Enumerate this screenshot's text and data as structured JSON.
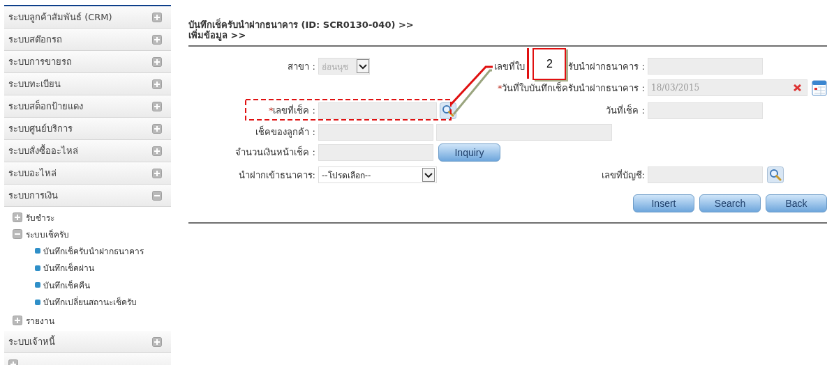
{
  "sidebar": {
    "items": [
      {
        "label": "ระบบลูกค้าสัมพันธ์ (CRM)",
        "expanded": false
      },
      {
        "label": "ระบบสต๊อกรถ",
        "expanded": false
      },
      {
        "label": "ระบบการขายรถ",
        "expanded": false
      },
      {
        "label": "ระบบทะเบียน",
        "expanded": false
      },
      {
        "label": "ระบบสต็อกป้ายแดง",
        "expanded": false
      },
      {
        "label": "ระบบศูนย์บริการ",
        "expanded": false
      },
      {
        "label": "ระบบสั่งซื้ออะไหล่",
        "expanded": false
      },
      {
        "label": "ระบบอะไหล่",
        "expanded": false
      },
      {
        "label": "ระบบการเงิน",
        "expanded": true,
        "children": [
          {
            "label": "รับชำระ",
            "expanded": false
          },
          {
            "label": "ระบบเช็ครับ",
            "expanded": true,
            "children": [
              {
                "label": "บันทึกเช็ครับนำฝากธนาคาร"
              },
              {
                "label": "บันทึกเช็คผ่าน"
              },
              {
                "label": "บันทึกเช็คคืน"
              },
              {
                "label": "บันทึกเปลี่ยนสถานะเช็ครับ"
              }
            ]
          },
          {
            "label": "รายงาน",
            "expanded": false
          }
        ]
      },
      {
        "label": "ระบบเจ้าหนี้",
        "expanded": false
      },
      {
        "expanded": false
      }
    ]
  },
  "page": {
    "title": "บันทึกเช็ครับนำฝากธนาคาร (ID: SCR0130-040) >>",
    "subtitle": "เพิ่มข้อมูล >>"
  },
  "form": {
    "branch": {
      "label": "สาขา :",
      "value": "อ่อนนุช",
      "disabled": true
    },
    "receipt_no": {
      "label_start": "เลขที่ใบ",
      "label_end": "รับนำฝากธนาคาร :"
    },
    "receipt_date": {
      "required_mark": "*",
      "label": "วันที่ใบบันทึกเช็ครับนำฝากธนาคาร :",
      "value": "18/03/2015",
      "disabled": true
    },
    "cheque_no": {
      "required_mark": "*",
      "label": "เลขที่เช็ค :"
    },
    "cheque_date": {
      "label": "วันที่เช็ค :"
    },
    "customer_cheque": {
      "label": "เช็คของลูกค้า :"
    },
    "amount": {
      "label": "จำนวนเงินหน้าเช็ค :"
    },
    "inquiry_button": "Inquiry",
    "deposit_bank": {
      "label": "นำฝากเข้าธนาคาร:",
      "value": "--โปรดเลือก--"
    },
    "account_no": {
      "label": "เลขที่บัญชี:"
    }
  },
  "buttons": [
    "Insert",
    "Search",
    "Back"
  ],
  "annotation": {
    "number": "2"
  }
}
